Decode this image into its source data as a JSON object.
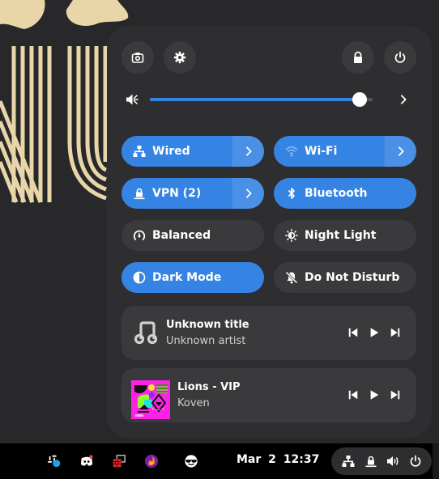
{
  "quick_settings": {
    "top_buttons": [
      {
        "id": "screenshot",
        "icon": "camera-icon"
      },
      {
        "id": "settings",
        "icon": "gear-icon"
      },
      {
        "id": "lock",
        "icon": "lock-icon"
      },
      {
        "id": "power",
        "icon": "power-icon"
      }
    ],
    "volume": {
      "icon": "speaker-muted-icon",
      "level_percent": 94,
      "arrow": "chevron-right-icon"
    },
    "tiles": [
      {
        "id": "wired",
        "label": "Wired",
        "icon": "network-wired-icon",
        "active": true,
        "has_menu": true
      },
      {
        "id": "wifi",
        "label": "Wi-Fi",
        "icon": "wifi-icon",
        "active": true,
        "has_menu": true
      },
      {
        "id": "vpn",
        "label": "VPN (2)",
        "icon": "vpn-lock-icon",
        "active": true,
        "has_menu": true
      },
      {
        "id": "bluetooth",
        "label": "Bluetooth",
        "icon": "bluetooth-icon",
        "active": true,
        "has_menu": false
      },
      {
        "id": "power-mode",
        "label": "Balanced",
        "icon": "power-profile-icon",
        "active": false,
        "has_menu": false
      },
      {
        "id": "night-light",
        "label": "Night Light",
        "icon": "night-light-icon",
        "active": false,
        "has_menu": false
      },
      {
        "id": "dark-mode",
        "label": "Dark Mode",
        "icon": "dark-mode-icon",
        "active": true,
        "has_menu": false
      },
      {
        "id": "dnd",
        "label": "Do Not Disturb",
        "icon": "bell-off-icon",
        "active": false,
        "has_menu": false
      }
    ],
    "media": [
      {
        "title": "Unknown title",
        "artist": "Unknown artist",
        "art": "music-note-icon"
      },
      {
        "title": "Lions - VIP",
        "artist": "Koven",
        "art": "album-art"
      }
    ]
  },
  "taskbar": {
    "apps": [
      {
        "name": "slack",
        "icon": "slack-icon"
      },
      {
        "name": "discord",
        "icon": "discord-icon"
      },
      {
        "name": "firewall",
        "icon": "firewall-icon"
      },
      {
        "name": "firefox",
        "icon": "firefox-icon"
      },
      {
        "name": "emoji",
        "icon": "sunglasses-emoji-icon"
      }
    ],
    "clock": "Mar 2  12:37",
    "status_icons": [
      "network-wired-icon",
      "vpn-lock-icon",
      "volume-icon",
      "power-icon"
    ]
  },
  "colors": {
    "accent": "#3584e4",
    "panel": "#2e2e30",
    "tile_off": "#3a3a3c",
    "wallpaper_line": "#e8d6a8"
  }
}
